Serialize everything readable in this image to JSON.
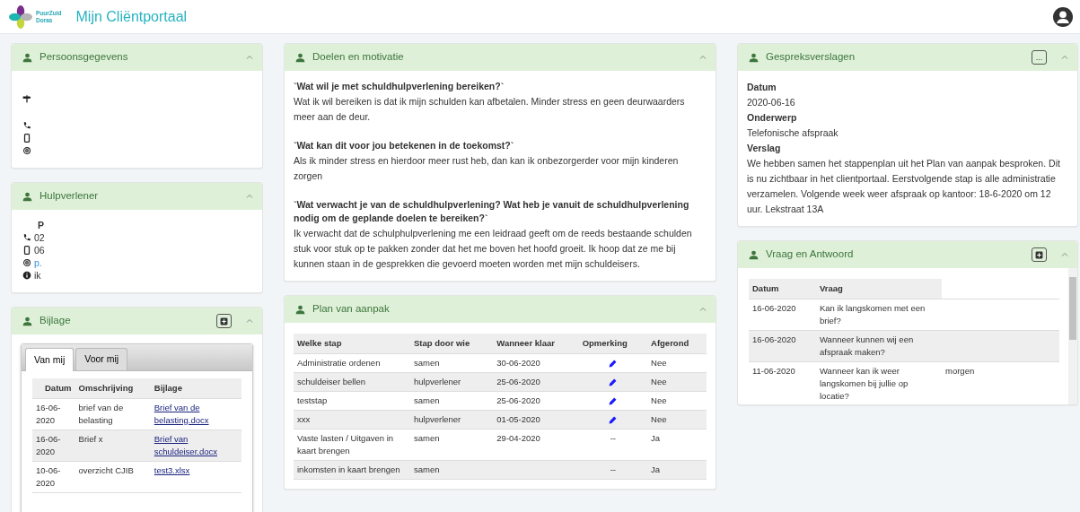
{
  "header": {
    "logo_text": [
      "PuurZuid",
      "Doras"
    ],
    "title": "Mijn Cliëntportaal"
  },
  "columns": [
    [
      {
        "kind": "contact",
        "title": "Persoonsgegevens",
        "lines": [
          {
            "kind": "address"
          },
          {
            "kind": "phone"
          },
          {
            "kind": "mobile"
          },
          {
            "kind": "email"
          }
        ]
      },
      {
        "kind": "contact",
        "title": "Hulpverlener",
        "lines": [
          {
            "kind": "name",
            "text": "P"
          },
          {
            "kind": "phone",
            "text": "02"
          },
          {
            "kind": "mobile",
            "text": "06"
          },
          {
            "kind": "email",
            "text": "p."
          },
          {
            "kind": "info",
            "text": "ik"
          }
        ]
      },
      {
        "kind": "attachments",
        "title": "Bijlage",
        "actions": [
          {
            "kind": "add"
          }
        ],
        "tabs": [
          {
            "label": "Van mij",
            "selected": true
          },
          {
            "label": "Voor mij",
            "selected": false
          }
        ],
        "columns": [
          "Datum",
          "Omschrijving",
          "Bijlage"
        ],
        "rows": [
          {
            "datum": "16-06-2020",
            "omschrijving": "brief van de belasting",
            "bijlage": "Brief van de belasting.docx"
          },
          {
            "datum": "16-06-2020",
            "omschrijving": "Brief x",
            "bijlage": "Brief van schuldeiser.docx"
          },
          {
            "datum": "10-06-2020",
            "omschrijving": "overzicht CJIB",
            "bijlage": "test3.xlsx"
          }
        ]
      }
    ],
    [
      {
        "kind": "questions",
        "title": "Doelen en motivatie",
        "sections": [
          {
            "question": "`Wat wil je met schuldhulpverlening bereiken?`",
            "answer": "Wat ik wil bereiken is dat ik mijn schulden kan afbetalen. Minder stress en geen deurwaarders meer aan de deur."
          },
          {
            "question": "`Wat kan dit voor jou betekenen in de toekomst?`",
            "answer": "Als ik minder stress en hierdoor meer rust heb, dan kan ik onbezorgerder voor mijn kinderen zorgen"
          },
          {
            "question": "`Wat verwacht je van de schuldhulpverlening? Wat heb je vanuit de schuldhulpverlening nodig om de geplande doelen te bereiken?`",
            "answer": "Ik verwacht dat de schulphulpverlening me een leidraad geeft om de reeds bestaande schulden stuk voor stuk op te pakken zonder dat het me boven het hoofd groeit. Ik hoop dat ze me bij kunnen staan in de gesprekken die gevoerd moeten worden met mijn schuldeisers."
          }
        ]
      },
      {
        "kind": "plan",
        "title": "Plan van aanpak",
        "columns": [
          "Welke stap",
          "Stap door wie",
          "Wanneer klaar",
          "Opmerking",
          "Afgerond"
        ],
        "rows": [
          {
            "stap": "Administratie ordenen",
            "wie": "samen",
            "klaar": "30-06-2020",
            "opmerking": {
              "kind": "edit"
            },
            "afgerond": "Nee"
          },
          {
            "stap": "schuldeiser bellen",
            "wie": "hulpverlener",
            "klaar": "25-06-2020",
            "opmerking": {
              "kind": "edit"
            },
            "afgerond": "Nee"
          },
          {
            "stap": "teststap",
            "wie": "samen",
            "klaar": "25-06-2020",
            "opmerking": {
              "kind": "edit"
            },
            "afgerond": "Nee"
          },
          {
            "stap": "xxx",
            "wie": "hulpverlener",
            "klaar": "01-05-2020",
            "opmerking": {
              "kind": "edit"
            },
            "afgerond": "Nee"
          },
          {
            "stap": "Vaste lasten / Uitgaven in kaart brengen",
            "wie": "samen",
            "klaar": "29-04-2020",
            "opmerking": {
              "kind": "text",
              "text": "--"
            },
            "afgerond": "Ja"
          },
          {
            "stap": "inkomsten in kaart brengen",
            "wie": "samen",
            "opmerking": {
              "kind": "text",
              "text": "--"
            },
            "afgerond": "Ja"
          }
        ]
      }
    ],
    [
      {
        "kind": "report",
        "title": "Gespreksverslagen",
        "actions": [
          {
            "kind": "more",
            "label": "..."
          }
        ],
        "fields": [
          {
            "label": "Datum",
            "value": "2020-06-16"
          },
          {
            "label": "Onderwerp",
            "value": "Telefonische afspraak"
          },
          {
            "label": "Verslag",
            "value": "We hebben samen het stappenplan uit het Plan van aanpak besproken. Dit is nu zichtbaar in het clientportaal. Eerstvolgende stap is alle administratie verzamelen. Volgende week weer afspraak op kantoor: 18-6-2020 om 12 uur. Lekstraat 13A"
          }
        ]
      },
      {
        "kind": "qa",
        "title": "Vraag en Antwoord",
        "actions": [
          {
            "kind": "add"
          }
        ],
        "columns": [
          "Datum",
          "Vraag"
        ],
        "rows": [
          {
            "datum": "16-06-2020",
            "vraag": "Kan ik langskomen met een brief?"
          },
          {
            "datum": "16-06-2020",
            "vraag": "Wanneer kunnen wij een afspraak maken?"
          },
          {
            "datum": "11-06-2020",
            "vraag": "Wanneer kan ik weer langskomen bij jullie op locatie?",
            "column_3": "morgen"
          }
        ]
      }
    ]
  ]
}
